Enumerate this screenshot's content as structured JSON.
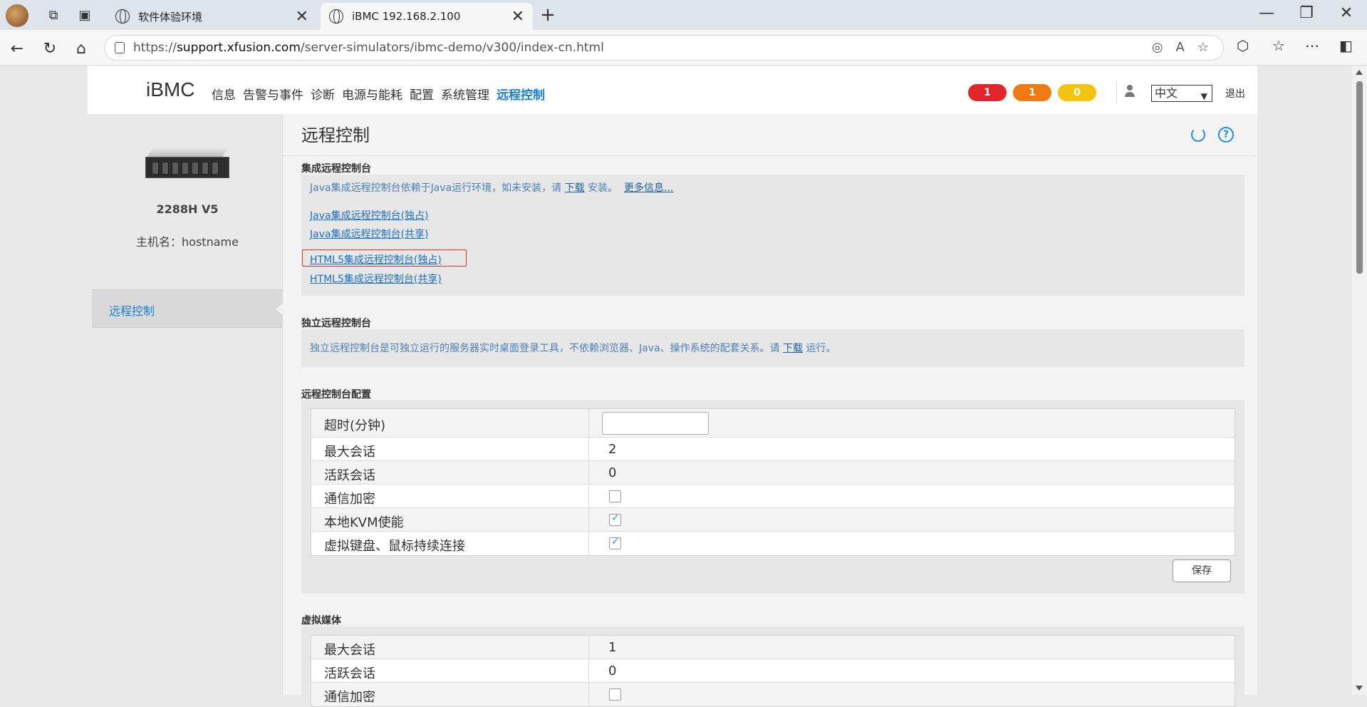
{
  "browser": {
    "tabs": [
      {
        "title": "软件体验环境",
        "active": false
      },
      {
        "title": "iBMC 192.168.2.100",
        "active": true
      }
    ],
    "url_prefix": "https://",
    "url_host": "support.xfusion.com",
    "url_path": "/server-simulators/ibmc-demo/v300/index-cn.html",
    "new_tab_label": "+",
    "tab_close": "✕",
    "win_minimize": "—",
    "win_restore": "❐",
    "win_close": "✕"
  },
  "header": {
    "brand": "iBMC",
    "nav": [
      "信息",
      "告警与事件",
      "诊断",
      "电源与能耗",
      "配置",
      "系统管理",
      "远程控制"
    ],
    "active_nav": "远程控制",
    "alarms": {
      "critical": "1",
      "major": "1",
      "minor": "0"
    },
    "alarm_colors": {
      "critical": "#e0262a",
      "major": "#ee7b12",
      "minor": "#f2c40f"
    },
    "language": "中文",
    "logout": "退出"
  },
  "sidebar": {
    "model": "2288H V5",
    "hostname": "主机名：hostname",
    "items": [
      "远程控制"
    ]
  },
  "main": {
    "title": "远程控制",
    "integrated": {
      "label": "集成远程控制台",
      "desc_prefix": "Java集成远程控制台依赖于Java运行环境，如未安装，请",
      "desc_download": "下载",
      "desc_suffix": "安装。",
      "desc_more": "更多信息...",
      "links": [
        "Java集成远程控制台(独占)",
        "Java集成远程控制台(共享)",
        "HTML5集成远程控制台(独占)",
        "HTML5集成远程控制台(共享)"
      ]
    },
    "standalone": {
      "label": "独立远程控制台",
      "desc_prefix": "独立远程控制台是可独立运行的服务器实时桌面登录工具，不依赖浏览器、Java、操作系统的配套关系。请",
      "desc_download": "下载",
      "desc_suffix": "运行。"
    },
    "config": {
      "label": "远程控制台配置",
      "rows": [
        {
          "label": "超时(分钟)",
          "type": "input",
          "value": ""
        },
        {
          "label": "最大会话",
          "type": "text",
          "value": "2"
        },
        {
          "label": "活跃会话",
          "type": "text",
          "value": "0"
        },
        {
          "label": "通信加密",
          "type": "checkbox",
          "checked": false
        },
        {
          "label": "本地KVM使能",
          "type": "checkbox",
          "checked": true
        },
        {
          "label": "虚拟键盘、鼠标持续连接",
          "type": "checkbox",
          "checked": true
        }
      ],
      "save": "保存"
    },
    "vmedia": {
      "label": "虚拟媒体",
      "rows": [
        {
          "label": "最大会话",
          "value": "1"
        },
        {
          "label": "活跃会话",
          "value": "0"
        },
        {
          "label": "通信加密",
          "value": ""
        }
      ]
    }
  }
}
